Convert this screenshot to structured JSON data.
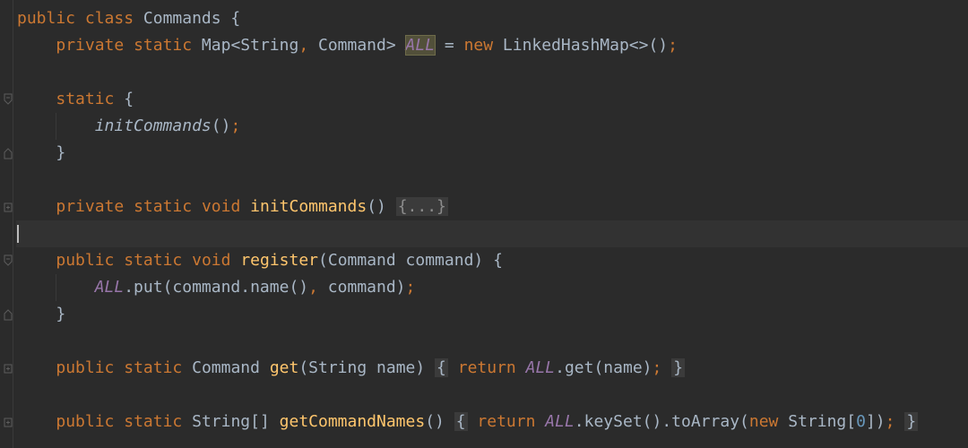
{
  "editor": {
    "lines": [
      {
        "tokens": [
          [
            "kw",
            "public"
          ],
          [
            "plain",
            " "
          ],
          [
            "kw",
            "class"
          ],
          [
            "plain",
            " Commands {"
          ]
        ]
      },
      {
        "tokens": [
          [
            "plain",
            "    "
          ],
          [
            "kw",
            "private"
          ],
          [
            "plain",
            " "
          ],
          [
            "kw",
            "static"
          ],
          [
            "plain",
            " Map<String"
          ],
          [
            "kw",
            ","
          ],
          [
            "plain",
            " Command> "
          ],
          [
            "hl",
            "ALL"
          ],
          [
            "plain",
            " = "
          ],
          [
            "kw",
            "new"
          ],
          [
            "plain",
            " LinkedHashMap<>()"
          ],
          [
            "kw",
            ";"
          ]
        ]
      },
      {
        "tokens": []
      },
      {
        "tokens": [
          [
            "plain",
            "    "
          ],
          [
            "kw",
            "static"
          ],
          [
            "plain",
            " {"
          ]
        ]
      },
      {
        "tokens": [
          [
            "plain",
            "        "
          ],
          [
            "ital",
            "initCommands"
          ],
          [
            "plain",
            "()"
          ],
          [
            "kw",
            ";"
          ]
        ]
      },
      {
        "tokens": [
          [
            "plain",
            "    }"
          ]
        ]
      },
      {
        "tokens": []
      },
      {
        "tokens": [
          [
            "plain",
            "    "
          ],
          [
            "kw",
            "private"
          ],
          [
            "plain",
            " "
          ],
          [
            "kw",
            "static"
          ],
          [
            "plain",
            " "
          ],
          [
            "kw",
            "void"
          ],
          [
            "plain",
            " "
          ],
          [
            "fn",
            "initCommands"
          ],
          [
            "plain",
            "() "
          ],
          [
            "fold",
            "{...}"
          ]
        ]
      },
      {
        "tokens": []
      },
      {
        "tokens": [
          [
            "plain",
            "    "
          ],
          [
            "kw",
            "public"
          ],
          [
            "plain",
            " "
          ],
          [
            "kw",
            "static"
          ],
          [
            "plain",
            " "
          ],
          [
            "kw",
            "void"
          ],
          [
            "plain",
            " "
          ],
          [
            "fn",
            "register"
          ],
          [
            "plain",
            "(Command command) {"
          ]
        ]
      },
      {
        "tokens": [
          [
            "plain",
            "        "
          ],
          [
            "sf",
            "ALL"
          ],
          [
            "plain",
            ".put(command.name()"
          ],
          [
            "kw",
            ","
          ],
          [
            "plain",
            " command)"
          ],
          [
            "kw",
            ";"
          ]
        ]
      },
      {
        "tokens": [
          [
            "plain",
            "    }"
          ]
        ]
      },
      {
        "tokens": []
      },
      {
        "tokens": [
          [
            "plain",
            "    "
          ],
          [
            "kw",
            "public"
          ],
          [
            "plain",
            " "
          ],
          [
            "kw",
            "static"
          ],
          [
            "plain",
            " Command "
          ],
          [
            "fn",
            "get"
          ],
          [
            "plain",
            "(String name) "
          ],
          [
            "box",
            "{"
          ],
          [
            "plain",
            " "
          ],
          [
            "kw",
            "return"
          ],
          [
            "plain",
            " "
          ],
          [
            "sf",
            "ALL"
          ],
          [
            "plain",
            ".get(name)"
          ],
          [
            "kw",
            ";"
          ],
          [
            "plain",
            " "
          ],
          [
            "box",
            "}"
          ]
        ]
      },
      {
        "tokens": []
      },
      {
        "tokens": [
          [
            "plain",
            "    "
          ],
          [
            "kw",
            "public"
          ],
          [
            "plain",
            " "
          ],
          [
            "kw",
            "static"
          ],
          [
            "plain",
            " String[] "
          ],
          [
            "fn",
            "getCommandNames"
          ],
          [
            "plain",
            "() "
          ],
          [
            "box",
            "{"
          ],
          [
            "plain",
            " "
          ],
          [
            "kw",
            "return"
          ],
          [
            "plain",
            " "
          ],
          [
            "sf",
            "ALL"
          ],
          [
            "plain",
            ".keySet().toArray("
          ],
          [
            "kw",
            "new"
          ],
          [
            "plain",
            " String["
          ],
          [
            "num",
            "0"
          ],
          [
            "plain",
            "])"
          ],
          [
            "kw",
            ";"
          ],
          [
            "plain",
            " "
          ],
          [
            "box",
            "}"
          ]
        ]
      }
    ]
  },
  "colors": {
    "background": "#2b2b2b",
    "keyword": "#cc7832",
    "function": "#ffc66d",
    "static_field": "#9876aa",
    "number": "#6897bb",
    "text": "#a9b7c6"
  }
}
